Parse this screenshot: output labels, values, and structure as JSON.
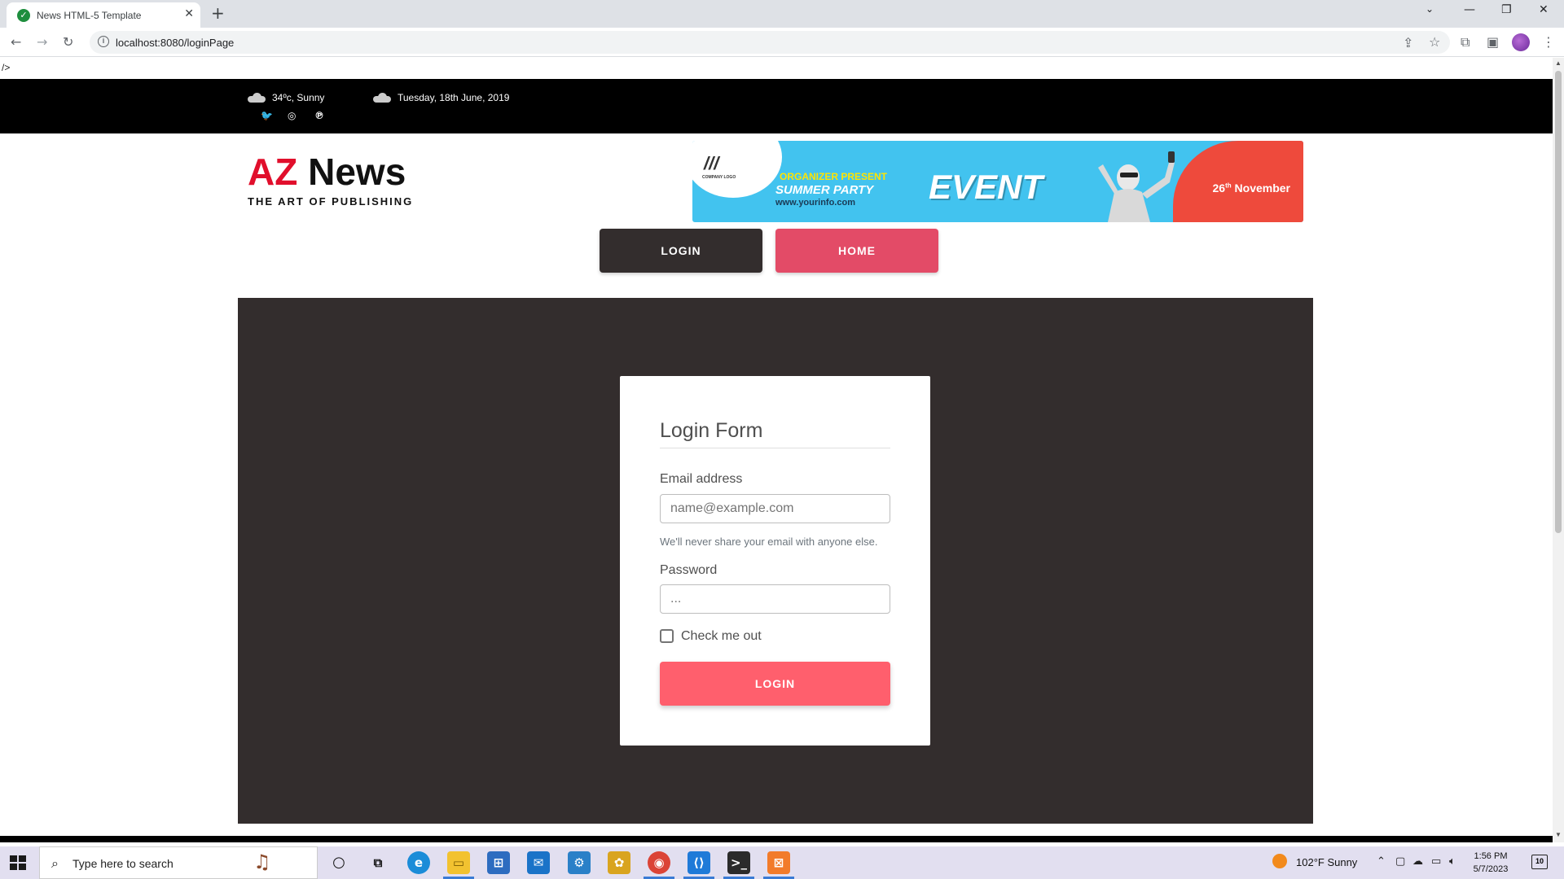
{
  "browser": {
    "tab_title": "News HTML-5 Template",
    "tab_close": "✕",
    "new_tab": "+",
    "url": "localhost:8080/loginPage",
    "window_controls": {
      "minimize": "—",
      "restore": "❐",
      "close": "✕"
    }
  },
  "page": {
    "stray_text": "/>",
    "topbar": {
      "weather": "34ºc, Sunny",
      "date": "Tuesday, 18th June, 2019",
      "social_icons": [
        "twitter-icon",
        "instagram-icon",
        "pinterest-icon"
      ]
    },
    "logo": {
      "az": "AZ",
      "news": " News",
      "tagline": "THE ART OF PUBLISHING"
    },
    "banner": {
      "logo_mark": "///",
      "logo_text": "COMPANY LOGO",
      "organizer": "ORGANIZER PRESENT",
      "summer_party": "SUMMER PARTY",
      "url": "www.yourinfo.com",
      "event": "EVENT",
      "date_day": "26",
      "date_sup": "th",
      "date_month": " November"
    },
    "nav": {
      "login": "LOGIN",
      "home": "HOME"
    },
    "form": {
      "title": "Login Form",
      "email_label": "Email address",
      "email_placeholder": "name@example.com",
      "email_help": "We'll never share your email with anyone else.",
      "password_label": "Password",
      "password_placeholder": "...",
      "check_label": "Check me out",
      "submit": "LOGIN"
    }
  },
  "taskbar": {
    "search_placeholder": "Type here to search",
    "weather": "102°F  Sunny",
    "time": "1:56 PM",
    "date": "5/7/2023",
    "notifications": "10"
  },
  "colors": {
    "brand_red": "#e10f2c",
    "nav_login_bg": "#332d2d",
    "nav_home_bg": "#e34b67",
    "panel_bg": "#332d2d",
    "submit_bg": "#ff5f6d",
    "banner_blue": "#42c3ef"
  }
}
